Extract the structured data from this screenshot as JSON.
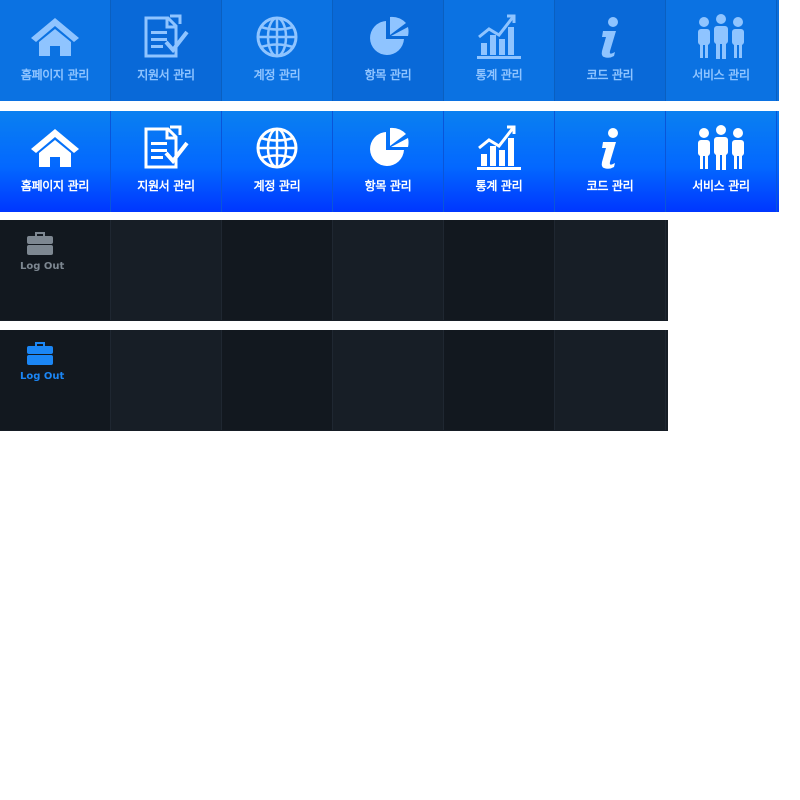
{
  "menu": {
    "items": [
      {
        "label": "홈페이지 관리",
        "icon": "home-icon"
      },
      {
        "label": "지원서 관리",
        "icon": "document-check-icon"
      },
      {
        "label": "계정 관리",
        "icon": "globe-icon"
      },
      {
        "label": "항목 관리",
        "icon": "pie-chart-icon"
      },
      {
        "label": "통계 관리",
        "icon": "bar-chart-icon"
      },
      {
        "label": "코드 관리",
        "icon": "info-icon"
      },
      {
        "label": "서비스 관리",
        "icon": "people-icon"
      }
    ],
    "normal_color": "#8fc4ff",
    "active_color": "#ffffff"
  },
  "logout": {
    "label": "Log Out",
    "icon": "briefcase-icon",
    "normal_color": "#7d8791",
    "active_color": "#1b86f5"
  }
}
